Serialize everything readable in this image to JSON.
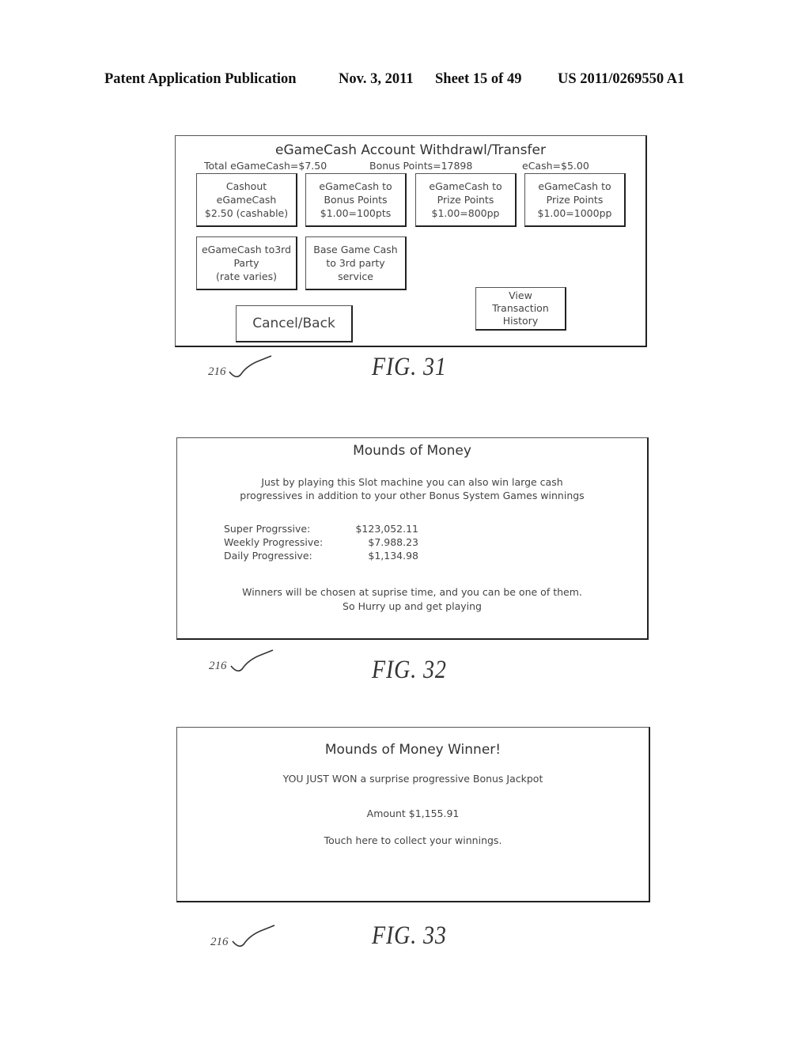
{
  "header": {
    "publication": "Patent Application Publication",
    "date": "Nov. 3, 2011",
    "sheet": "Sheet 15 of 49",
    "number": "US 2011/0269550 A1"
  },
  "fig31": {
    "title": "eGameCash Account Withdrawl/Transfer",
    "total": "Total eGameCash=$7.50",
    "bonus_points": "Bonus Points=17898",
    "ecash": "eCash=$5.00",
    "buttons": [
      {
        "lines": [
          "Cashout",
          "eGameCash",
          "$2.50 (cashable)"
        ]
      },
      {
        "lines": [
          "eGameCash to",
          "Bonus Points",
          "$1.00=100pts"
        ]
      },
      {
        "lines": [
          "eGameCash to",
          "Prize Points",
          "$1.00=800pp"
        ]
      },
      {
        "lines": [
          "eGameCash to",
          "Prize Points",
          "$1.00=1000pp"
        ]
      },
      {
        "lines": [
          "eGameCash to3rd",
          "Party",
          "(rate varies)"
        ]
      },
      {
        "lines": [
          "Base Game Cash",
          "to 3rd party",
          "service"
        ]
      }
    ],
    "cancel": "Cancel/Back",
    "history": {
      "lines": [
        "View",
        "Transaction",
        "History"
      ]
    },
    "ref": "216",
    "label": "FIG. 31"
  },
  "fig32": {
    "title": "Mounds of Money",
    "intro": [
      "Just by playing this Slot machine you can also win large cash",
      "progressives in addition to your other Bonus System Games winnings"
    ],
    "progressives": [
      {
        "label": "Super Progrssive:",
        "value": "$123,052.11"
      },
      {
        "label": "Weekly Progressive:",
        "value": "$7.988.23"
      },
      {
        "label": "Daily Progressive:",
        "value": "$1,134.98"
      }
    ],
    "outro": [
      "Winners will be chosen at suprise time, and you can be one of them.",
      "So Hurry up and get playing"
    ],
    "ref": "216",
    "label": "FIG. 32"
  },
  "fig33": {
    "title": "Mounds of Money Winner!",
    "line1": "YOU JUST WON a surprise progressive Bonus Jackpot",
    "amount": "Amount $1,155.91",
    "collect": "Touch here to collect your winnings.",
    "ref": "216",
    "label": "FIG. 33"
  }
}
